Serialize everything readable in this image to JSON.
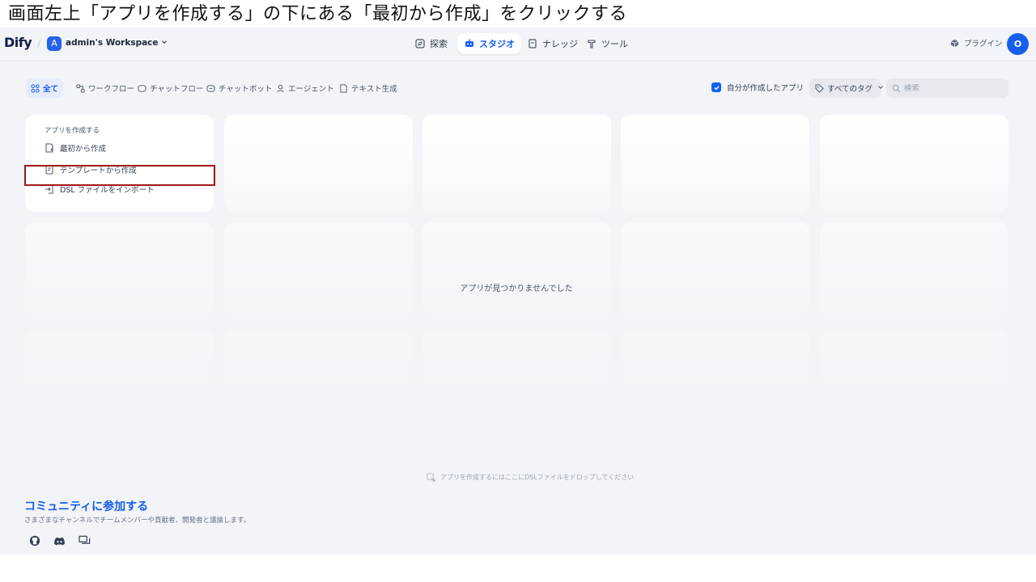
{
  "instruction": "画面左上「アプリを作成する」の下にある「最初から作成」をクリックする",
  "header": {
    "logo": "Dify",
    "separator": "/",
    "workspace_initial": "A",
    "workspace_name": "admin's Workspace",
    "nav": [
      {
        "label": "探索",
        "icon": "compass-icon",
        "active": false
      },
      {
        "label": "スタジオ",
        "icon": "robot-icon",
        "active": true
      },
      {
        "label": "ナレッジ",
        "icon": "book-icon",
        "active": false
      },
      {
        "label": "ツール",
        "icon": "hammer-icon",
        "active": false
      }
    ],
    "plugin_label": "プラグイン",
    "avatar_initial": "O"
  },
  "filters": {
    "tabs": [
      {
        "label": "全て",
        "icon": "grid-icon",
        "active": true
      },
      {
        "label": "ワークフロー",
        "icon": "workflow-icon",
        "active": false
      },
      {
        "label": "チャットフロー",
        "icon": "chatflow-icon",
        "active": false
      },
      {
        "label": "チャットボット",
        "icon": "chatbot-icon",
        "active": false
      },
      {
        "label": "エージェント",
        "icon": "agent-icon",
        "active": false
      },
      {
        "label": "テキスト生成",
        "icon": "text-generation-icon",
        "active": false
      }
    ],
    "created_by_me_label": "自分が作成したアプリ",
    "created_by_me_checked": true,
    "tags_label": "すべてのタグ",
    "search_placeholder": "検索"
  },
  "create_card": {
    "title": "アプリを作成する",
    "items": [
      {
        "label": "最初から作成",
        "icon": "new-file-icon"
      },
      {
        "label": "テンプレートから作成",
        "icon": "template-icon"
      },
      {
        "label": "DSL ファイルをインポート",
        "icon": "import-icon"
      }
    ]
  },
  "empty_message": "アプリが見つかりませんでした",
  "drop_hint": "アプリを作成するにはここにDSLファイルをドロップしてください",
  "community": {
    "title": "コミュニティに参加する",
    "description": "さまざまなチャンネルでチームメンバーや貢献者、開発者と議論します。",
    "links": [
      "github-icon",
      "discord-icon",
      "forum-icon"
    ]
  },
  "colors": {
    "accent": "#155eef",
    "background": "#f2f4f7",
    "highlight_box": "#a01818"
  }
}
